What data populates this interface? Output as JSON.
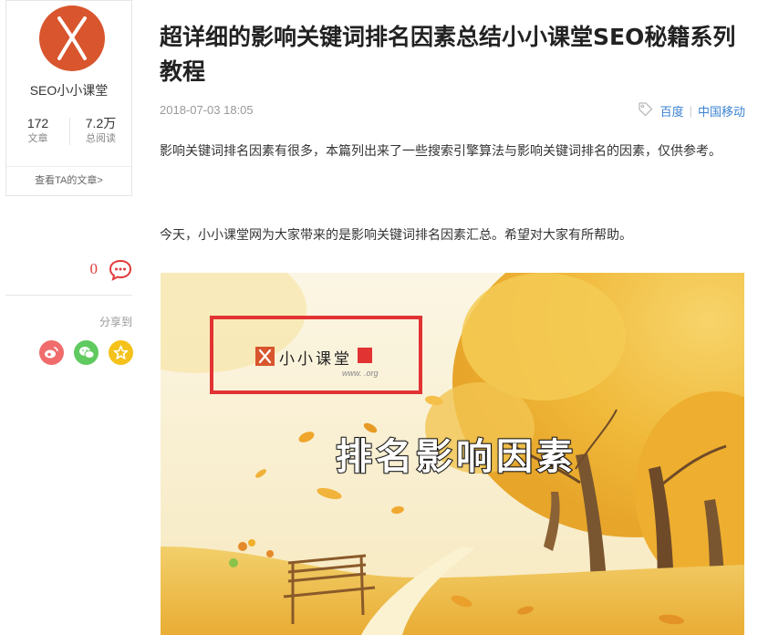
{
  "author": {
    "name": "SEO小小课堂",
    "stats": [
      {
        "value": "172",
        "label": "文章"
      },
      {
        "value": "7.2万",
        "label": "总阅读"
      }
    ],
    "footer_link": "查看TA的文章>"
  },
  "sidebar": {
    "comment_count": "0",
    "share_label": "分享到",
    "share_icons": [
      "weibo-icon",
      "wechat-icon",
      "qzone-icon"
    ]
  },
  "article": {
    "title": "超详细的影响关键词排名因素总结小小课堂SEO秘籍系列教程",
    "date": "2018-07-03 18:05",
    "tags": [
      "百度",
      "中国移动"
    ],
    "paragraphs": [
      "影响关键词排名因素有很多，本篇列出来了一些搜索引擎算法与影响关键词排名的因素，仅供参考。",
      "今天，小小课堂网为大家带来的是影响关键词排名因素汇总。希望对大家有所帮助。"
    ],
    "image": {
      "headline": "排名影响因素",
      "logo_text": "小小课堂",
      "logo_url": "www.     .org"
    }
  },
  "colors": {
    "accent_red": "#e23b3b",
    "avatar_orange": "#d9552d",
    "link_blue": "#3b83d1",
    "weibo": "#f06c6c",
    "wechat": "#5fca5f",
    "qzone": "#f4c21b"
  }
}
